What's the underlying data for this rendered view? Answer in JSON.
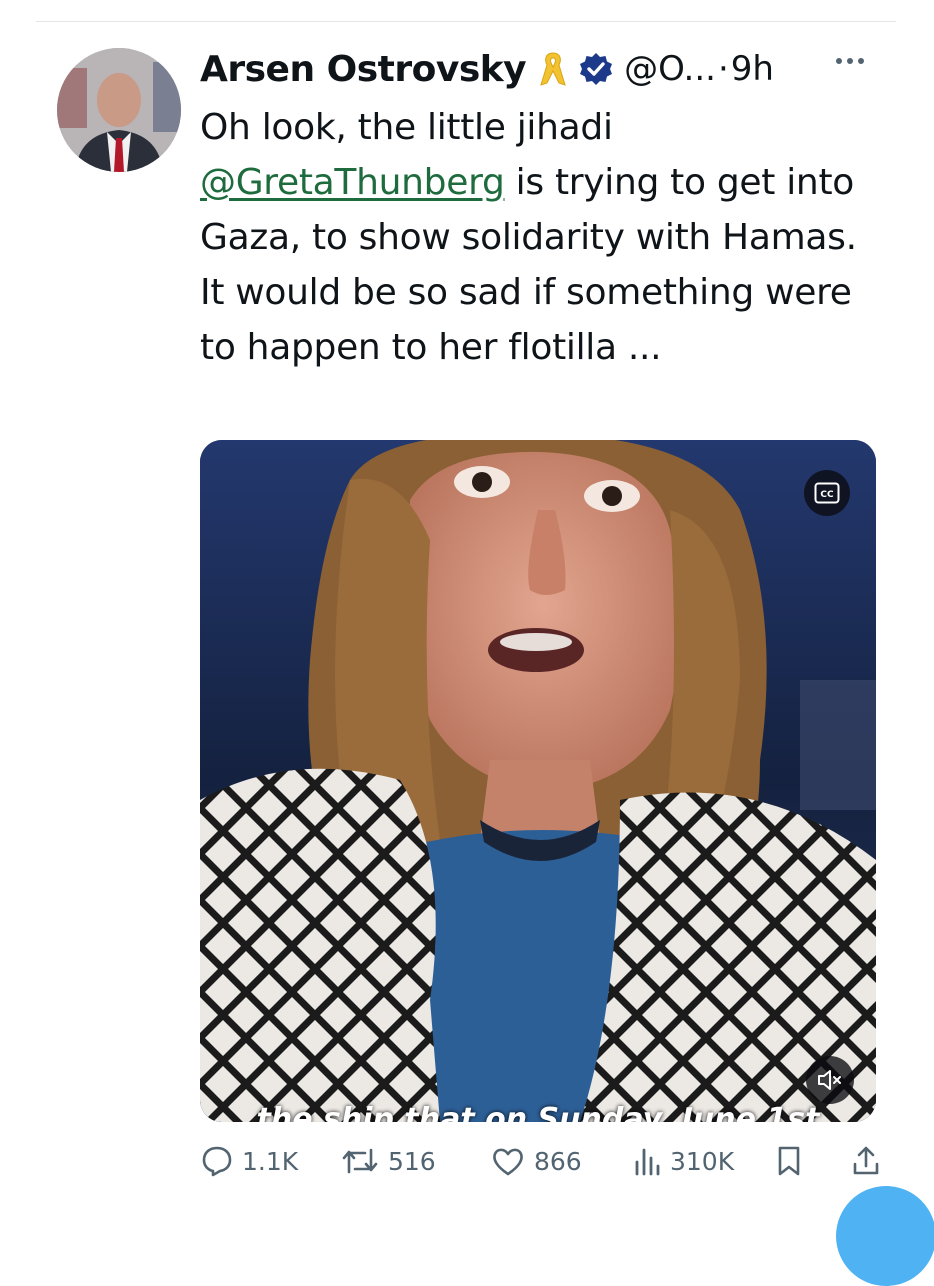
{
  "author": {
    "name": "Arsen Ostrovsky",
    "handle": "@O...",
    "separator": "·",
    "time": "9h"
  },
  "tweet": {
    "text_before": "Oh look, the little jihadi ",
    "mention": "@GretaThunberg",
    "text_after": " is trying to get into Gaza, to show solidarity with Hamas. It would be so sad if something were to happen to her flotilla ..."
  },
  "media": {
    "caption": "the ship that on Sunday, June 1st",
    "cc_label": "CC"
  },
  "actions": {
    "replies": "1.1K",
    "retweets": "516",
    "likes": "866",
    "views": "310K"
  },
  "colors": {
    "mention": "#1e6b3e",
    "verified": "#1d3a8a",
    "ribbon": "#f2c230",
    "muted_text": "#536471"
  },
  "icons": [
    "ribbon-icon",
    "verified-icon",
    "more-icon",
    "cc-icon",
    "mute-icon",
    "reply-icon",
    "retweet-icon",
    "like-icon",
    "views-icon",
    "bookmark-icon",
    "share-icon"
  ]
}
